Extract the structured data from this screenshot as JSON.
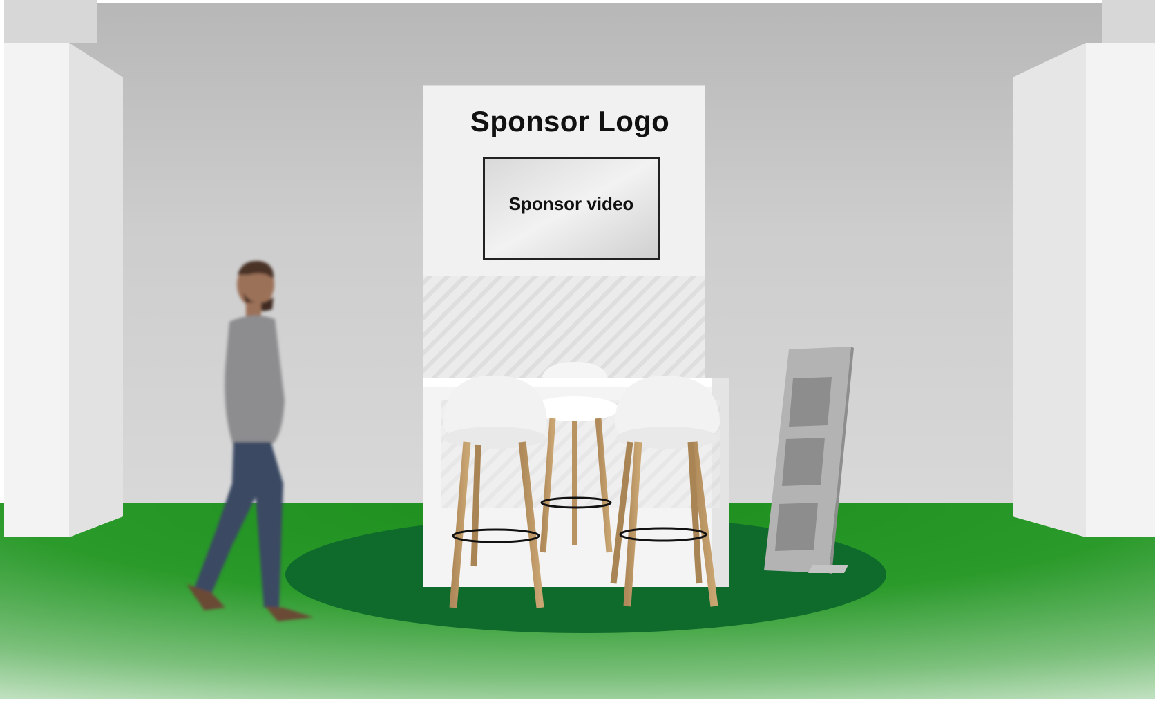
{
  "booth": {
    "logo_text": "Sponsor Logo",
    "video_text": "Sponsor video"
  },
  "colors": {
    "wall": "#c9c9c9",
    "floor": "#1f8f1f",
    "carpet": "#0f6b2c",
    "panel": "#ececec",
    "stand": "#a8a8a8"
  },
  "icons": [
    "person",
    "bar-stool",
    "high-table",
    "brochure-stand",
    "video-screen",
    "pillar"
  ]
}
